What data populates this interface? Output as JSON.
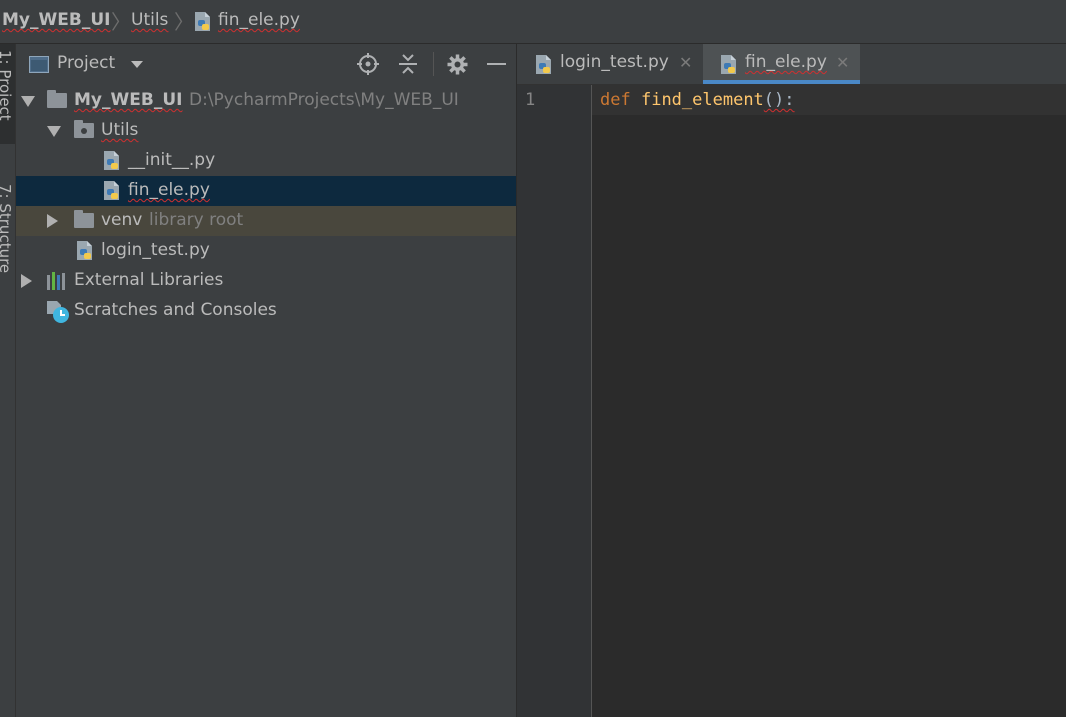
{
  "breadcrumb": {
    "project": "My_WEB_UI",
    "folder": "Utils",
    "file": "fin_ele.py"
  },
  "tool_windows": {
    "project_tab": "1: Project",
    "structure_tab": "7: Structure"
  },
  "project_panel": {
    "title": "Project",
    "tree": {
      "root_name": "My_WEB_UI",
      "root_path": "D:\\PycharmProjects\\My_WEB_UI",
      "utils": "Utils",
      "init_file": "__init__.py",
      "fin_file": "fin_ele.py",
      "venv": "venv",
      "venv_hint": "library root",
      "login_file": "login_test.py",
      "external_libraries": "External Libraries",
      "scratches": "Scratches and Consoles"
    }
  },
  "editor": {
    "tabs": [
      {
        "label": "login_test.py",
        "active": false
      },
      {
        "label": "fin_ele.py",
        "active": true
      }
    ],
    "line_number": "1",
    "code": {
      "keyword": "def",
      "function": "find_element",
      "punct": "():"
    }
  },
  "colors": {
    "keyword": "#cc7832",
    "function": "#ffc66d",
    "selection": "#0d293e",
    "venv_row": "#49473d",
    "active_tab_underline": "#4a88c7"
  }
}
